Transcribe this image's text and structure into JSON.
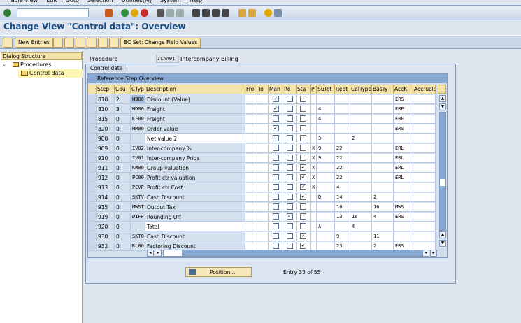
{
  "menu": [
    "Table View",
    "Edit",
    "Goto",
    "Selection",
    "Utilities(M)",
    "System",
    "Help"
  ],
  "title": "Change View \"Control data\": Overview",
  "toolbar": {
    "new_entries": "New Entries",
    "bc_set": "BC Set: Change Field Values"
  },
  "dialog": {
    "heading": "Dialog Structure",
    "items": [
      "Procedures",
      "Control data"
    ]
  },
  "procedure": {
    "label": "Procedure",
    "value": "ICAA01",
    "description": "Intercompany Billing"
  },
  "tab": "Control data",
  "table": {
    "title": "Reference Step Overview",
    "columns": [
      "Step",
      "Cou",
      "CTyp",
      "Description",
      "Fro",
      "To",
      "Man",
      "Re",
      "Sta",
      "P",
      "SuTot",
      "Reqt",
      "CalType",
      "BasTy",
      "AccK",
      "Accruals"
    ],
    "rows": [
      [
        "810",
        "2",
        "HB00",
        "Discount (Value)",
        "",
        "",
        true,
        false,
        false,
        "",
        "",
        "",
        "",
        "",
        "ERS",
        ""
      ],
      [
        "810",
        "3",
        "HD00",
        "Freight",
        "",
        "",
        true,
        false,
        false,
        "",
        "4",
        "",
        "",
        "",
        "ERF",
        ""
      ],
      [
        "815",
        "0",
        "KF00",
        "Freight",
        "",
        "",
        false,
        false,
        false,
        "",
        "4",
        "",
        "",
        "",
        "ERF",
        ""
      ],
      [
        "820",
        "0",
        "HM00",
        "Order value",
        "",
        "",
        true,
        false,
        false,
        "",
        "",
        "",
        "",
        "",
        "ERS",
        ""
      ],
      [
        "900",
        "0",
        "",
        "Net value 2",
        "",
        "",
        false,
        false,
        false,
        "",
        "3",
        "",
        "2",
        "",
        "",
        ""
      ],
      [
        "909",
        "0",
        "IV02",
        "Inter-company %",
        "",
        "",
        false,
        false,
        false,
        "X",
        "9",
        "22",
        "",
        "",
        "ERL",
        ""
      ],
      [
        "910",
        "0",
        "IV01",
        "Inter-company Price",
        "",
        "",
        false,
        false,
        false,
        "X",
        "9",
        "22",
        "",
        "",
        "ERL",
        ""
      ],
      [
        "911",
        "0",
        "KW00",
        "Group valuation",
        "",
        "",
        false,
        false,
        true,
        "X",
        "",
        "22",
        "",
        "",
        "ERL",
        ""
      ],
      [
        "912",
        "0",
        "PC00",
        "Profit ctr valuation",
        "",
        "",
        false,
        false,
        true,
        "X",
        "",
        "22",
        "",
        "",
        "ERL",
        ""
      ],
      [
        "913",
        "0",
        "PCVP",
        "Profit ctr Cost",
        "",
        "",
        false,
        false,
        true,
        "X",
        "",
        "4",
        "",
        "",
        "",
        ""
      ],
      [
        "914",
        "0",
        "SKTV",
        "Cash Discount",
        "",
        "",
        false,
        false,
        true,
        "",
        "D",
        "14",
        "",
        "2",
        "",
        ""
      ],
      [
        "915",
        "0",
        "MWST",
        "Output Tax",
        "",
        "",
        false,
        false,
        false,
        "",
        "",
        "10",
        "",
        "16",
        "MWS",
        ""
      ],
      [
        "919",
        "0",
        "DIFF",
        "Rounding Off",
        "",
        "",
        false,
        true,
        false,
        "",
        "",
        "13",
        "16",
        "4",
        "ERS",
        ""
      ],
      [
        "920",
        "0",
        "",
        "Total",
        "",
        "",
        false,
        false,
        false,
        "",
        "A",
        "",
        "4",
        "",
        "",
        ""
      ],
      [
        "930",
        "0",
        "SKTO",
        "Cash Discount",
        "",
        "",
        false,
        false,
        true,
        "",
        "",
        "9",
        "",
        "11",
        "",
        ""
      ],
      [
        "932",
        "0",
        "RL00",
        "Factoring Discount",
        "",
        "",
        false,
        false,
        true,
        "",
        "",
        "23",
        "",
        "2",
        "ERS",
        ""
      ]
    ]
  },
  "position_button": "Position...",
  "entry_info": "Entry 33 of 55"
}
